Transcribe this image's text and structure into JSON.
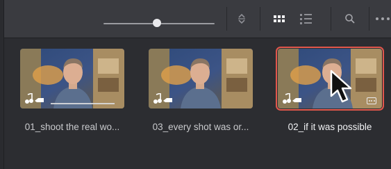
{
  "toolbar": {
    "zoom_slider_level": 0.45,
    "icons": [
      "sort-updown-icon",
      "thumbnail-grid-icon",
      "list-view-icon",
      "search-icon",
      "more-options-icon"
    ]
  },
  "clips": [
    {
      "label": "01_shoot the real wo...",
      "selected": false,
      "has_progress": true
    },
    {
      "label": "03_every shot was or...",
      "selected": false,
      "has_progress": false
    },
    {
      "label": "02_if it was possible",
      "selected": true,
      "has_progress": false
    }
  ],
  "colors": {
    "selection_outline": "#e2574c",
    "panel_bg": "#2c2d31",
    "toolbar_bg": "#3a3b40"
  }
}
